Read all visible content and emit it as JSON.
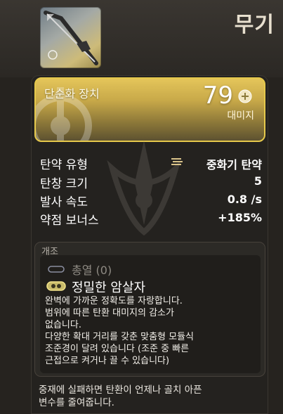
{
  "window": {
    "title": "무기",
    "accent_color": "#e6c94b"
  },
  "item": {
    "thumbnail_icon": "rifle-thumbnail-icon",
    "name": "단순화 장치",
    "damage_value": "79",
    "damage_label": "대미지",
    "damage_icon": "damage-element-icon"
  },
  "stats": [
    {
      "label": "탄약 유형",
      "value": "중화기 탄약",
      "icon": "heavy-ammo-icon"
    },
    {
      "label": "탄창 크기",
      "value": "5"
    },
    {
      "label": "발사 속도",
      "value": "0.8 /s"
    },
    {
      "label": "약점 보너스",
      "value": "+185%"
    }
  ],
  "mods": {
    "section_label": "개조",
    "items": [
      {
        "name": "총열",
        "count": "(0)",
        "icon": "perk-slot-empty-icon"
      },
      {
        "name": "정밀한 암살자",
        "icon": "perk-slot-active-icon",
        "description": "완벽에 가까운 정확도를 자랑합니다.\n범위에 따른 탄환 대미지의 감소가\n없습니다.\n다양한 확대 거리를 갖춘 맞춤형 모듈식\n조준경이 달려 있습니다 (조준 중 빠른\n근접으로 켜거나 끌 수 있습니다)"
      }
    ]
  },
  "footer": {
    "text": "중재에 실패하면 탄환이 언제나 골치 아픈\n변수를 줄여줍니다."
  }
}
